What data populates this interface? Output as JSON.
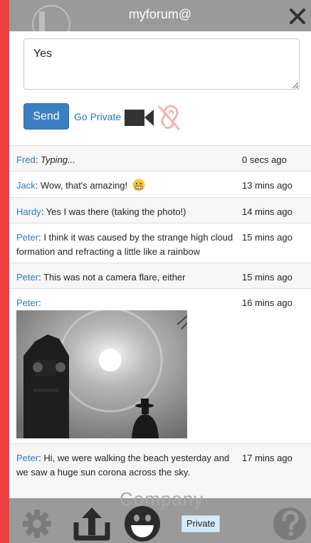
{
  "header": {
    "title": "myforum@"
  },
  "compose": {
    "input_value": "Yes",
    "send_label": "Send",
    "private_link": "Go Private"
  },
  "messages": [
    {
      "user": "Fred",
      "text": "Typing...",
      "time": "0 secs ago",
      "typing": true
    },
    {
      "user": "Jack",
      "text": "Wow, that's amazing!",
      "time": "13 mins ago",
      "emoji": "grimace"
    },
    {
      "user": "Hardy",
      "text": "Yes I was there (taking the photo!)",
      "time": "14 mins ago"
    },
    {
      "user": "Peter",
      "text": "I think it was caused by the strange high cloud formation and refracting a little like a rainbow",
      "time": "15 mins ago"
    },
    {
      "user": "Peter",
      "text": "This was not a camera flare, either",
      "time": "15 mins ago"
    },
    {
      "user": "Peter",
      "text": "",
      "time": "16 mins ago",
      "image": "clock tower with sun halo"
    },
    {
      "user": "Peter",
      "text": "Hi, we were walking the beach yesterday and we saw a huge sun corona across the sky.",
      "time": "17 mins ago"
    }
  ],
  "footer": {
    "watermark": "Company",
    "private_toggle": "Private"
  },
  "icons": {
    "close": "close-icon",
    "video": "video-camera-icon",
    "ear": "ear-muted-icon",
    "settings": "gear-icon",
    "upload": "upload-icon",
    "emoji": "smiley-icon",
    "help": "help-icon"
  },
  "colors": {
    "accent": "#3a7fc4",
    "link": "#2a78c0",
    "sidebar": "#ec4140",
    "chrome": "#9a9a9a"
  }
}
